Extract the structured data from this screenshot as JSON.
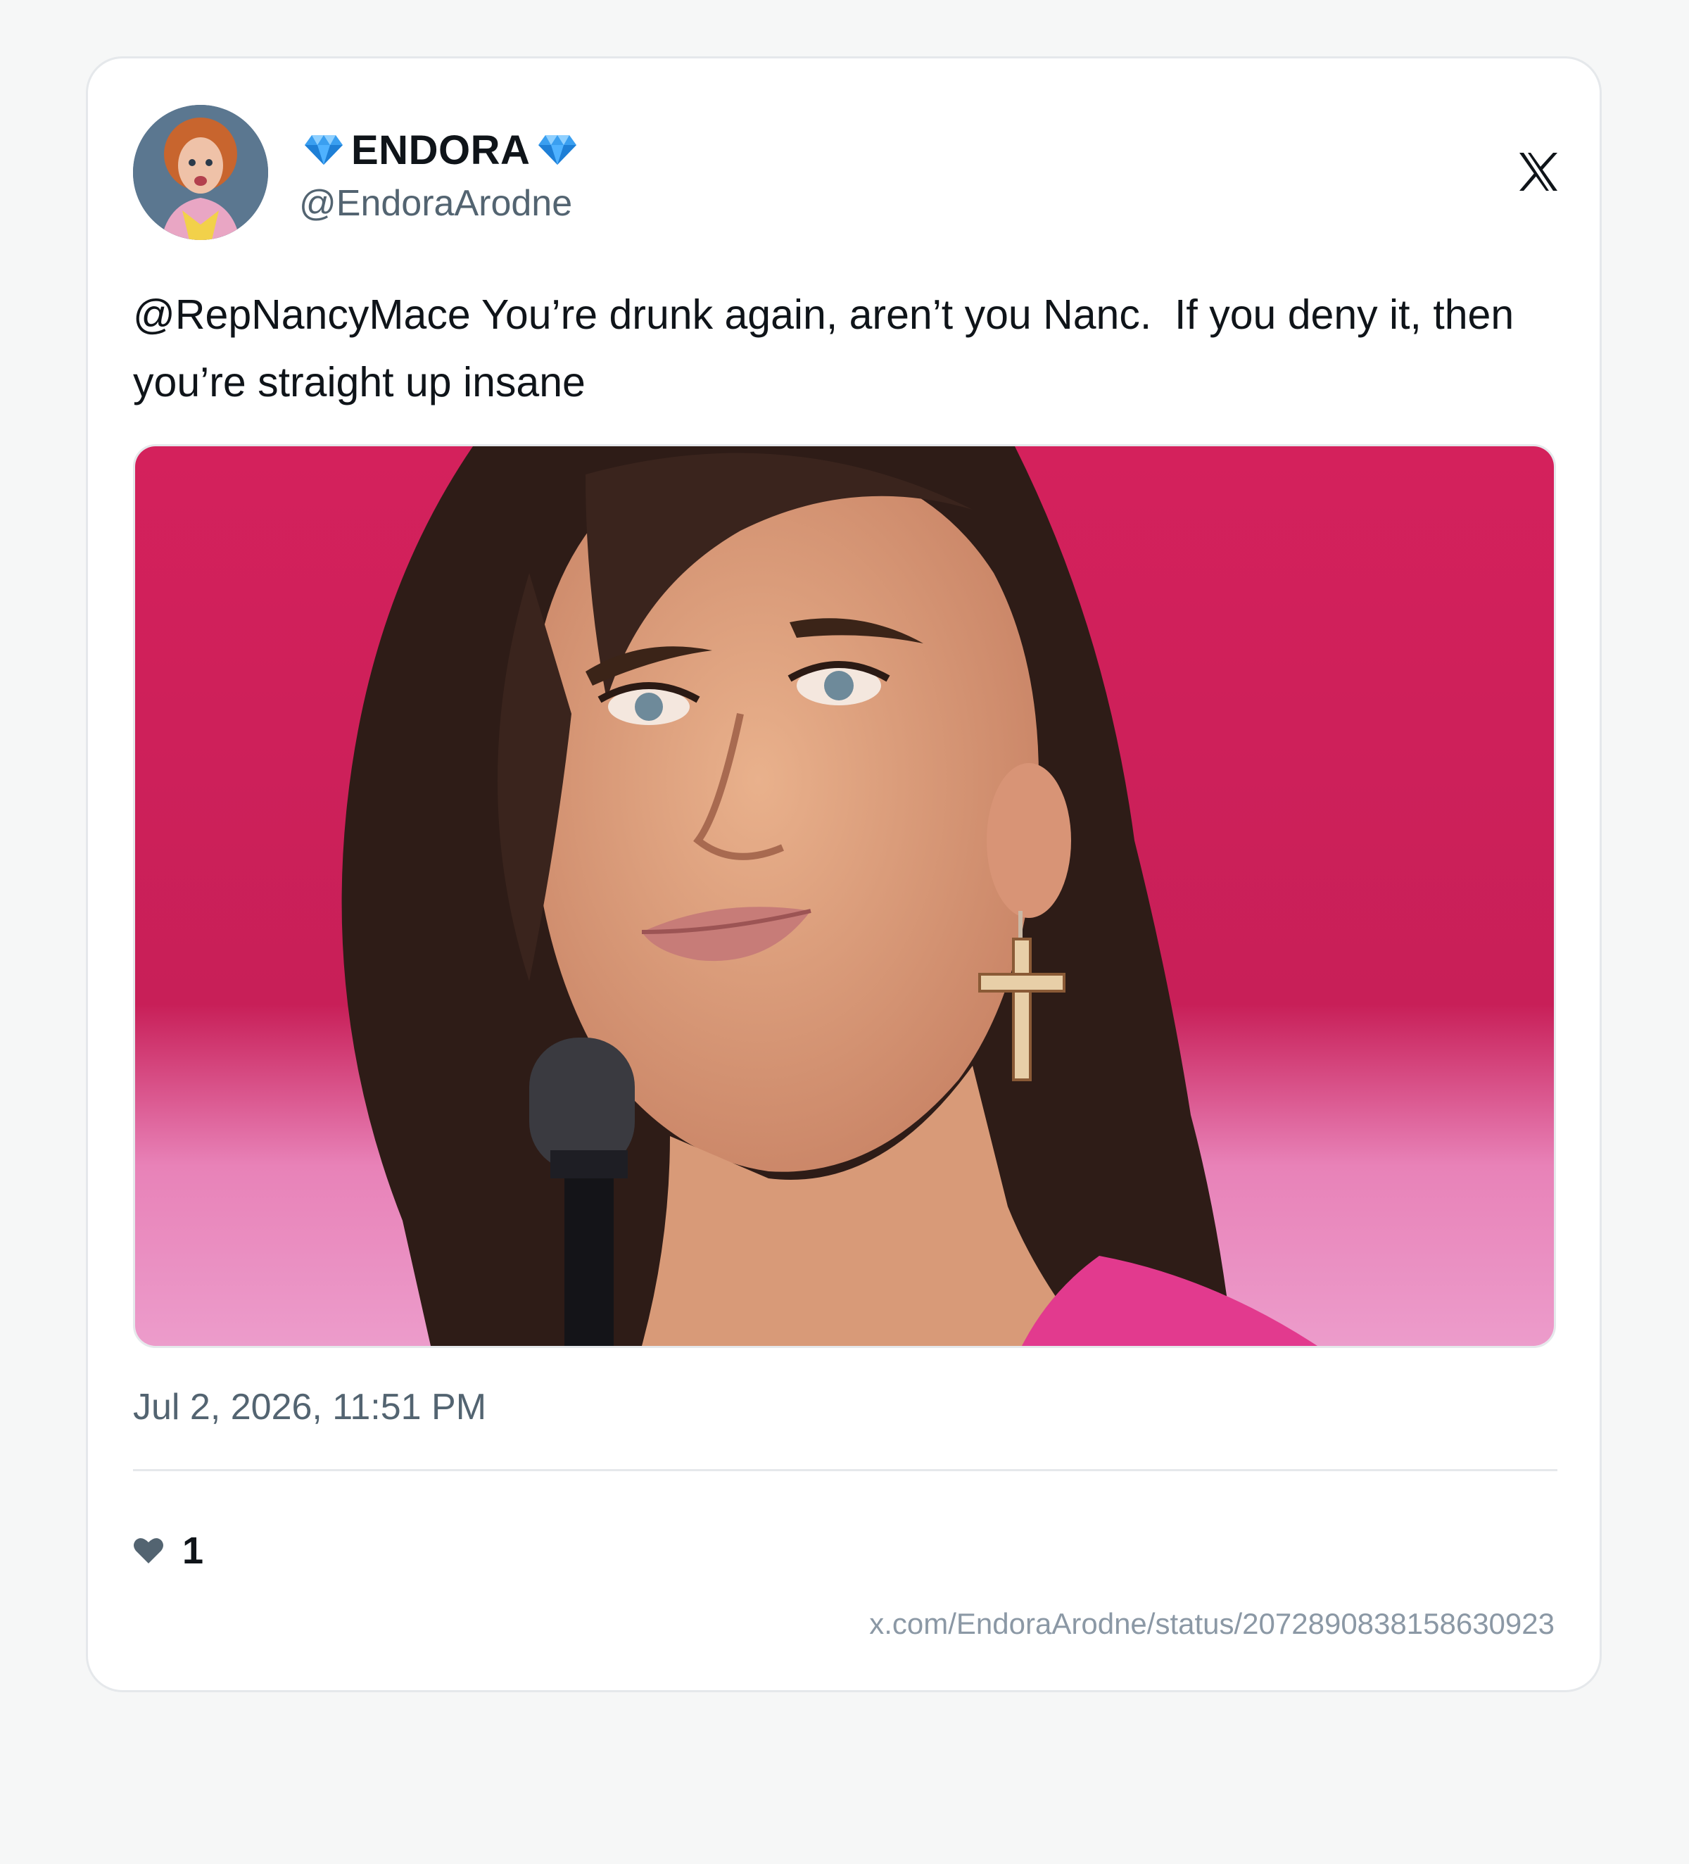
{
  "tweet": {
    "display_name": "ENDORA",
    "display_name_emoji": "gem-icon",
    "handle": "@EndoraArodne",
    "text": "@RepNancyMace You’re drunk again, aren’t you Nanc.  If you deny it, then you’re straight up insane",
    "timestamp": "Jul 2, 2026, 11:51 PM",
    "likes": "1",
    "status_url": "x.com/EndoraArodne/status/2072890838158630923",
    "platform_logo": "x-logo-icon"
  },
  "colors": {
    "name": "#0f1419",
    "secondary": "#536471",
    "divider": "#e5e8eb",
    "gem": "#3a9ff0",
    "media_background": "#d21f5a"
  }
}
